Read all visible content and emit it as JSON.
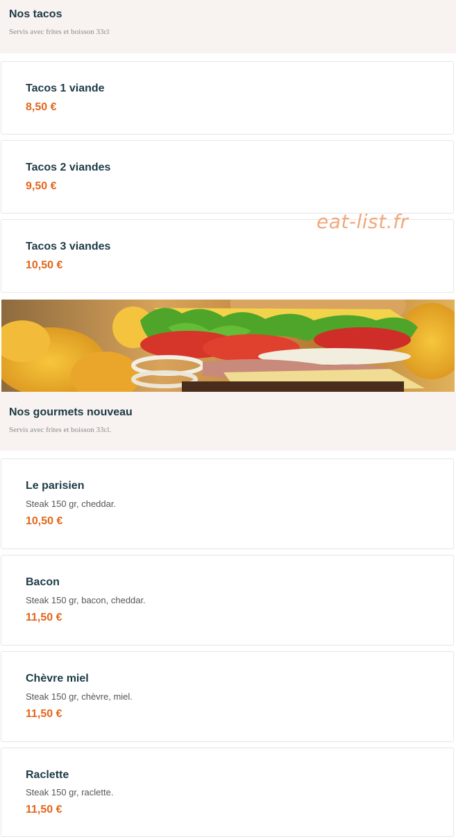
{
  "tacos_section": {
    "title": "Nos tacos",
    "subtitle": "Servis avec frites et boisson 33cl"
  },
  "tacos_items": [
    {
      "name": "Tacos 1 viande",
      "price": "8,50 €"
    },
    {
      "name": "Tacos 2 viandes",
      "price": "9,50 €"
    },
    {
      "name": "Tacos 3 viandes",
      "price": "10,50 €"
    }
  ],
  "watermark": "eat-list.fr",
  "gourmets_section": {
    "title": "Nos gourmets nouveau",
    "subtitle": "Servis avec frites et boisson 33cl."
  },
  "gourmets_items": [
    {
      "name": "Le parisien",
      "desc": "Steak 150 gr, cheddar.",
      "price": "10,50 €"
    },
    {
      "name": "Bacon",
      "desc": "Steak 150 gr, bacon, cheddar.",
      "price": "11,50 €"
    },
    {
      "name": "Chèvre miel",
      "desc": "Steak 150 gr, chèvre, miel.",
      "price": "11,50 €"
    },
    {
      "name": "Raclette",
      "desc": "Steak 150 gr, raclette.",
      "price": "11,50 €"
    }
  ],
  "colors": {
    "accent_price": "#e2661b",
    "title_text": "#1c3a46",
    "section_bg": "#f8f3f1"
  }
}
